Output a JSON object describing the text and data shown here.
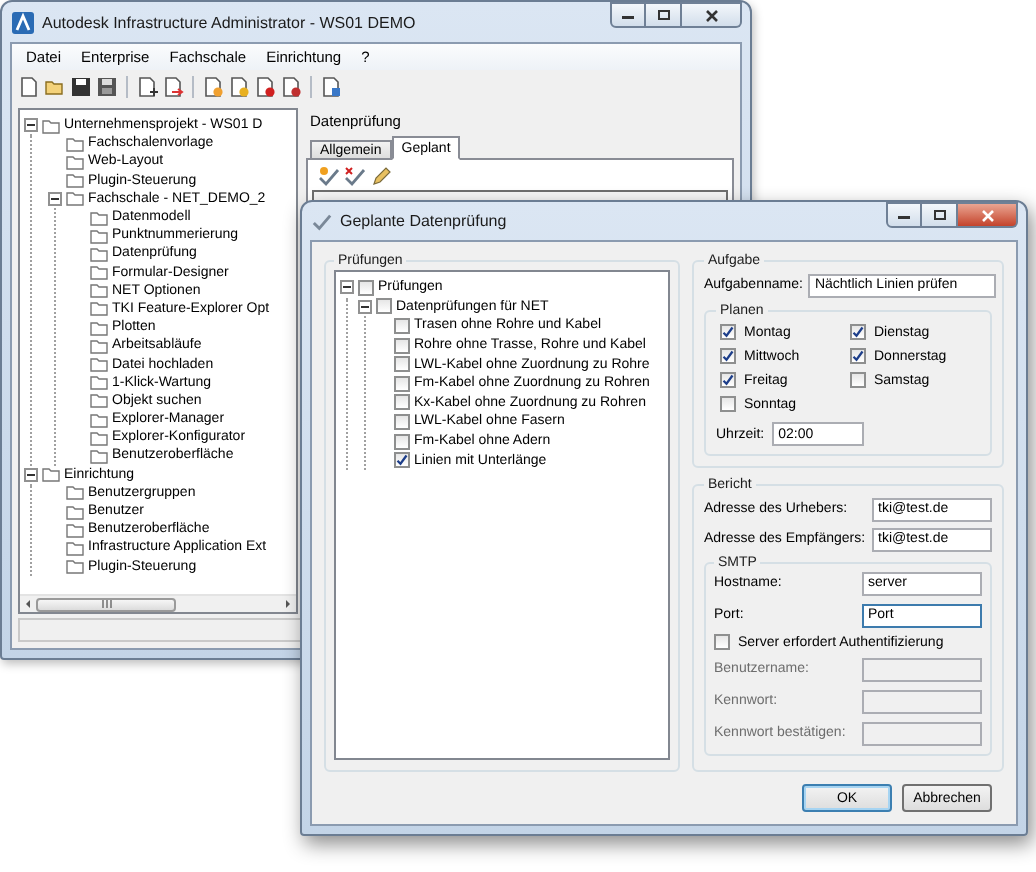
{
  "main_window": {
    "title": "Autodesk Infrastructure Administrator - WS01 DEMO",
    "menu": [
      "Datei",
      "Enterprise",
      "Fachschale",
      "Einrichtung",
      "?"
    ],
    "tree": [
      {
        "label": "Unternehmensprojekt - WS01 D",
        "expanded": true,
        "children": [
          {
            "label": "Fachschalenvorlage"
          },
          {
            "label": "Web-Layout"
          },
          {
            "label": "Plugin-Steuerung"
          },
          {
            "label": "Fachschale - NET_DEMO_2",
            "expanded": true,
            "children": [
              {
                "label": "Datenmodell"
              },
              {
                "label": "Punktnummerierung"
              },
              {
                "label": "Datenprüfung"
              },
              {
                "label": "Formular-Designer"
              },
              {
                "label": "NET Optionen"
              },
              {
                "label": "TKI Feature-Explorer Opt"
              },
              {
                "label": "Plotten"
              },
              {
                "label": "Arbeitsabläufe"
              },
              {
                "label": "Datei hochladen"
              },
              {
                "label": "1-Klick-Wartung"
              },
              {
                "label": "Objekt suchen"
              },
              {
                "label": "Explorer-Manager"
              },
              {
                "label": "Explorer-Konfigurator"
              },
              {
                "label": "Benutzeroberfläche"
              }
            ]
          }
        ]
      },
      {
        "label": "Einrichtung",
        "expanded": true,
        "children": [
          {
            "label": "Benutzergruppen"
          },
          {
            "label": "Benutzer"
          },
          {
            "label": "Benutzeroberfläche"
          },
          {
            "label": "Infrastructure Application Ext"
          },
          {
            "label": "Plugin-Steuerung"
          }
        ]
      }
    ],
    "panel": {
      "title": "Datenprüfung",
      "tabs": [
        {
          "label": "Allgemein",
          "selected": false
        },
        {
          "label": "Geplant",
          "selected": true
        }
      ]
    }
  },
  "dialog": {
    "title": "Geplante Datenprüfung",
    "checks": {
      "title": "Prüfungen",
      "tree": [
        {
          "label": "Prüfungen",
          "checked": false,
          "expanded": true,
          "children": [
            {
              "label": "Datenprüfungen für NET",
              "checked": false,
              "expanded": true,
              "children": [
                {
                  "label": "Trasen ohne Rohre und Kabel",
                  "checked": false
                },
                {
                  "label": "Rohre ohne Trasse, Rohre und Kabel",
                  "checked": false
                },
                {
                  "label": "LWL-Kabel ohne Zuordnung zu Rohre",
                  "checked": false
                },
                {
                  "label": "Fm-Kabel ohne Zuordnung zu Rohren",
                  "checked": false
                },
                {
                  "label": "Kx-Kabel ohne Zuordnung zu Rohren",
                  "checked": false
                },
                {
                  "label": "LWL-Kabel ohne Fasern",
                  "checked": false
                },
                {
                  "label": "Fm-Kabel ohne Adern",
                  "checked": false
                },
                {
                  "label": "Linien mit Unterlänge",
                  "checked": true
                }
              ]
            }
          ]
        }
      ]
    },
    "task": {
      "title": "Aufgabe",
      "name_label": "Aufgabenname:",
      "name_value": "Nächtlich Linien prüfen",
      "schedule": {
        "title": "Planen",
        "days": [
          {
            "label": "Montag",
            "checked": true
          },
          {
            "label": "Dienstag",
            "checked": true
          },
          {
            "label": "Mittwoch",
            "checked": true
          },
          {
            "label": "Donnerstag",
            "checked": true
          },
          {
            "label": "Freitag",
            "checked": true
          },
          {
            "label": "Samstag",
            "checked": false
          },
          {
            "label": "Sonntag",
            "checked": false
          }
        ],
        "time_label": "Uhrzeit:",
        "time_value": "02:00"
      }
    },
    "report": {
      "title": "Bericht",
      "fields": [
        {
          "label": "Adresse des Urhebers:",
          "value": "tki@test.de"
        },
        {
          "label": "Adresse des Empfängers:",
          "value": "tki@test.de"
        }
      ],
      "smtp": {
        "title": "SMTP",
        "fields": [
          {
            "label": "Hostname:",
            "value": "server",
            "focused": false
          },
          {
            "label": "Port:",
            "value": "Port",
            "focused": true
          }
        ],
        "auth": {
          "label": "Server erfordert Authentifizierung",
          "checked": false
        },
        "auth_fields": [
          {
            "label": "Benutzername:",
            "disabled": true
          },
          {
            "label": "Kennwort:",
            "disabled": true
          },
          {
            "label": "Kennwort bestätigen:",
            "disabled": true
          }
        ]
      }
    },
    "buttons": [
      {
        "label": "OK",
        "default": true
      },
      {
        "label": "Abbrechen",
        "default": false
      }
    ]
  }
}
